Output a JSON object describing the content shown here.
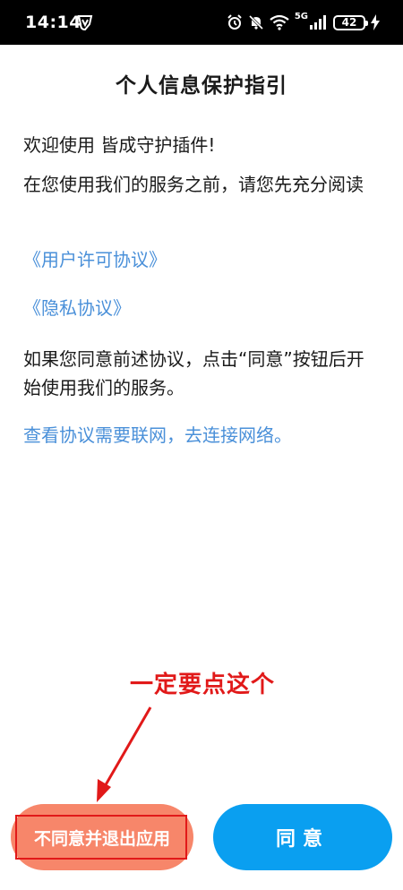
{
  "status_bar": {
    "time": "14:14",
    "battery": "42",
    "network": "5G",
    "icons": [
      "shield-icon",
      "alarm-icon",
      "mute-icon",
      "wifi-icon",
      "signal-icon",
      "battery-icon",
      "charging-icon"
    ]
  },
  "page": {
    "title": "个人信息保护指引",
    "welcome": "欢迎使用 皆成守护插件!",
    "before_use": "在您使用我们的服务之前，请您先充分阅读",
    "user_agreement_link": "《用户许可协议》",
    "privacy_link": "《隐私协议》",
    "agree_hint": "如果您同意前述协议，点击“同意”按钮后开始使用我们的服务。",
    "network_link": "查看协议需要联网，去连接网络。"
  },
  "annotation": {
    "text": "一定要点这个",
    "color": "#e11919"
  },
  "buttons": {
    "disagree_label": "不同意并退出应用",
    "agree_label": "同意"
  },
  "colors": {
    "link": "#4a90d9",
    "disagree_bg": "#f7866a",
    "agree_bg": "#0a9ff0"
  }
}
